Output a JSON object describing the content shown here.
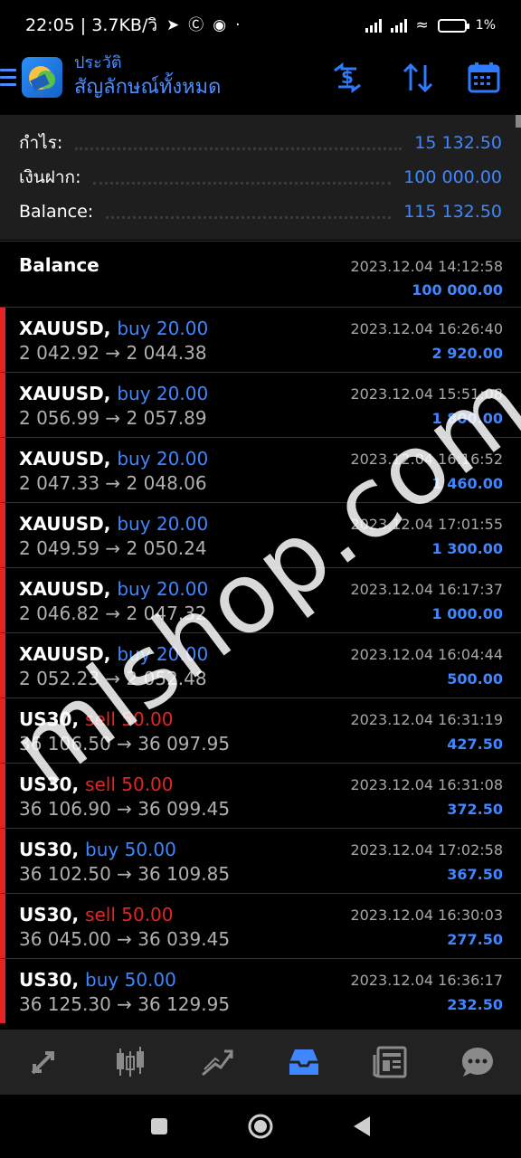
{
  "status_bar": {
    "time_speed": "22:05 | 3.7KB/วิ",
    "battery": "1%"
  },
  "header": {
    "title": "ประวัติ",
    "subtitle": "สัญลักษณ์ทั้งหมด"
  },
  "summary": {
    "profit_label": "กำไร:",
    "profit_value": "15 132.50",
    "deposit_label": "เงินฝาก:",
    "deposit_value": "100 000.00",
    "balance_label": "Balance:",
    "balance_value": "115 132.50"
  },
  "balance_row": {
    "label": "Balance",
    "time": "2023.12.04 14:12:58",
    "amount": "100 000.00"
  },
  "trades": [
    {
      "symbol": "XAUUSD,",
      "side": "buy 20.00",
      "type": "buy",
      "prices": "2 042.92 → 2 044.38",
      "time": "2023.12.04 16:26:40",
      "profit": "2 920.00"
    },
    {
      "symbol": "XAUUSD,",
      "side": "buy 20.00",
      "type": "buy",
      "prices": "2 056.99 → 2 057.89",
      "time": "2023.12.04 15:51:08",
      "profit": "1 800.00"
    },
    {
      "symbol": "XAUUSD,",
      "side": "buy 20.00",
      "type": "buy",
      "prices": "2 047.33 → 2 048.06",
      "time": "2023.12.04 16:16:52",
      "profit": "1 460.00"
    },
    {
      "symbol": "XAUUSD,",
      "side": "buy 20.00",
      "type": "buy",
      "prices": "2 049.59 → 2 050.24",
      "time": "2023.12.04 17:01:55",
      "profit": "1 300.00"
    },
    {
      "symbol": "XAUUSD,",
      "side": "buy 20.00",
      "type": "buy",
      "prices": "2 046.82 → 2 047.32",
      "time": "2023.12.04 16:17:37",
      "profit": "1 000.00"
    },
    {
      "symbol": "XAUUSD,",
      "side": "buy 20.00",
      "type": "buy",
      "prices": "2 052.23 → 2 052.48",
      "time": "2023.12.04 16:04:44",
      "profit": "500.00"
    },
    {
      "symbol": "US30,",
      "side": "sell 50.00",
      "type": "sell",
      "prices": "36 106.50 → 36 097.95",
      "time": "2023.12.04 16:31:19",
      "profit": "427.50"
    },
    {
      "symbol": "US30,",
      "side": "sell 50.00",
      "type": "sell",
      "prices": "36 106.90 → 36 099.45",
      "time": "2023.12.04 16:31:08",
      "profit": "372.50"
    },
    {
      "symbol": "US30,",
      "side": "buy 50.00",
      "type": "buy",
      "prices": "36 102.50 → 36 109.85",
      "time": "2023.12.04 17:02:58",
      "profit": "367.50"
    },
    {
      "symbol": "US30,",
      "side": "sell 50.00",
      "type": "sell",
      "prices": "36 045.00 → 36 039.45",
      "time": "2023.12.04 16:30:03",
      "profit": "277.50"
    },
    {
      "symbol": "US30,",
      "side": "buy 50.00",
      "type": "buy",
      "prices": "36 125.30 → 36 129.95",
      "time": "2023.12.04 16:36:17",
      "profit": "232.50"
    }
  ],
  "watermark": "mlshop.com",
  "colors": {
    "accent": "#3f86ff",
    "sell": "#e52323",
    "loss_bar": "#e52323"
  },
  "tabs": [
    {
      "icon": "quotes-icon"
    },
    {
      "icon": "chart-icon"
    },
    {
      "icon": "trade-icon"
    },
    {
      "icon": "history-icon",
      "active": true
    },
    {
      "icon": "news-icon"
    },
    {
      "icon": "chat-icon"
    }
  ]
}
